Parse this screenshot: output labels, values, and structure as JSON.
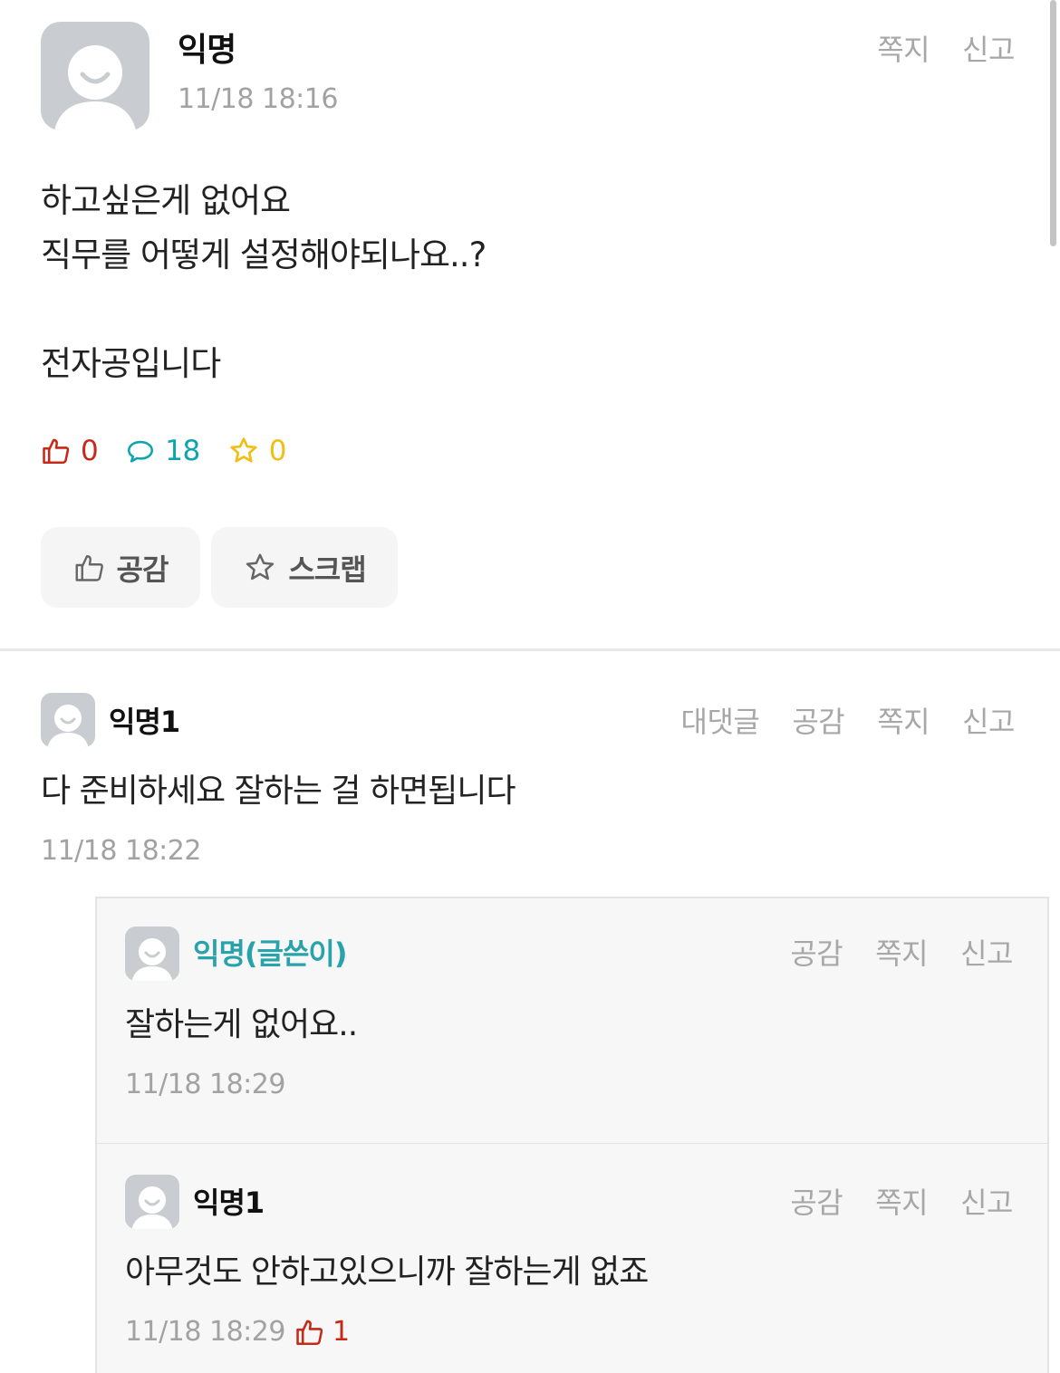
{
  "post": {
    "author": "익명",
    "time": "11/18 18:16",
    "actions": {
      "message": "쪽지",
      "report": "신고"
    },
    "body": [
      "하고싶은게 없어요",
      "직무를 어떻게 설정해야되나요..?",
      "",
      "전자공입니다"
    ],
    "stats": {
      "likes": "0",
      "comments": "18",
      "scraps": "0"
    },
    "buttons": {
      "like": "공감",
      "scrap": "스크랩"
    }
  },
  "comments": [
    {
      "author": "익명1",
      "text": "다 준비하세요 잘하는 걸 하면됩니다",
      "time": "11/18 18:22",
      "actions": {
        "reply": "대댓글",
        "like": "공감",
        "message": "쪽지",
        "report": "신고"
      }
    }
  ],
  "replies": [
    {
      "author": "익명(글쓴이)",
      "text": "잘하는게 없어요..",
      "time": "11/18 18:29",
      "actions": {
        "like": "공감",
        "message": "쪽지",
        "report": "신고"
      }
    },
    {
      "author": "익명1",
      "text": "아무것도 안하고있으니까 잘하는게 없죠",
      "time": "11/18 18:29",
      "likes": "1",
      "actions": {
        "like": "공감",
        "message": "쪽지",
        "report": "신고"
      }
    }
  ],
  "icons": {
    "like": "thumbs-up-icon",
    "comment": "speech-bubble-icon",
    "scrap": "star-icon",
    "avatar": "default-avatar-icon"
  },
  "colors": {
    "like": "#c62917",
    "comment": "#0ca5af",
    "scrap": "#f2be15",
    "op_author": "#29a3ab",
    "muted": "#a2a2a2"
  }
}
